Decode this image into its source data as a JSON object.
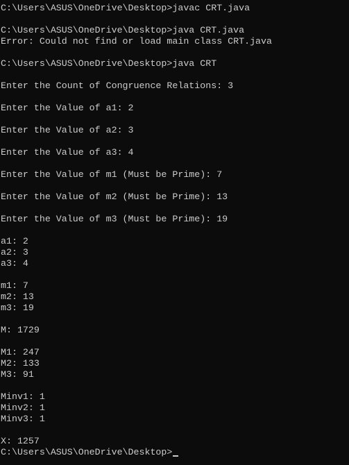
{
  "terminal": {
    "lines": [
      "C:\\Users\\ASUS\\OneDrive\\Desktop>javac CRT.java",
      "",
      "C:\\Users\\ASUS\\OneDrive\\Desktop>java CRT.java",
      "Error: Could not find or load main class CRT.java",
      "",
      "C:\\Users\\ASUS\\OneDrive\\Desktop>java CRT",
      "",
      "Enter the Count of Congruence Relations: 3",
      "",
      "Enter the Value of a1: 2",
      "",
      "Enter the Value of a2: 3",
      "",
      "Enter the Value of a3: 4",
      "",
      "Enter the Value of m1 (Must be Prime): 7",
      "",
      "Enter the Value of m2 (Must be Prime): 13",
      "",
      "Enter the Value of m3 (Must be Prime): 19",
      "",
      "a1: 2",
      "a2: 3",
      "a3: 4",
      "",
      "m1: 7",
      "m2: 13",
      "m3: 19",
      "",
      "M: 1729",
      "",
      "M1: 247",
      "M2: 133",
      "M3: 91",
      "",
      "Minv1: 1",
      "Minv2: 1",
      "Minv3: 1",
      "",
      "X: 1257",
      "C:\\Users\\ASUS\\OneDrive\\Desktop>"
    ]
  }
}
